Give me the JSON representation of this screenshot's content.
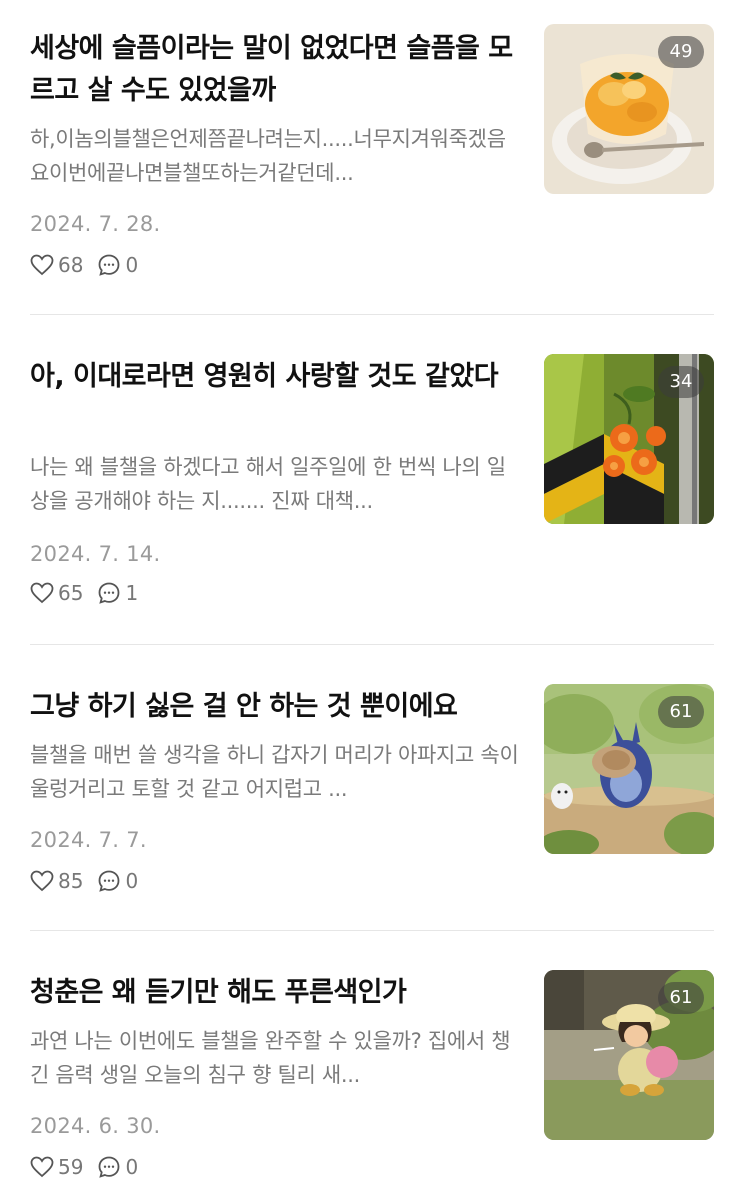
{
  "posts": [
    {
      "title": "세상에 슬픔이라는 말이 없었다면 슬픔을 모르고 살 수도 있었을까",
      "excerpt": "하,이놈의블챌은언제쯤끝나려는지.....너무지겨워죽겠음요이번에끝나면블챌또하는거같던데...",
      "date": "2024. 7. 28.",
      "likes": "68",
      "comments": "0",
      "photo_count": "49",
      "thumb_icon": "mango-dessert-photo"
    },
    {
      "title": "아, 이대로라면 영원히 사랑할 것도 같았다",
      "excerpt": "나는 왜 블챌을 하겠다고 해서 일주일에 한 번씩 나의 일상을 공개해야 하는 지....... 진짜 대책...",
      "date": "2024. 7. 14.",
      "likes": "65",
      "comments": "1",
      "photo_count": "34",
      "thumb_icon": "orange-flowers-photo"
    },
    {
      "title": "그냥 하기 싫은 걸 안 하는 것 뿐이에요",
      "excerpt": "블챌을 매번 쓸 생각을 하니 갑자기 머리가 아파지고 속이 울렁거리고 토할 것 같고 어지럽고 ...",
      "date": "2024. 7. 7.",
      "likes": "85",
      "comments": "0",
      "photo_count": "61",
      "thumb_icon": "totoro-anime-still"
    },
    {
      "title": "청춘은 왜 듣기만 해도 푸른색인가",
      "excerpt": "과연 나는 이번에도 블챌을 완주할 수 있을까? 집에서 챙긴 음력 생일 오늘의 침구 향 틸리 새...",
      "date": "2024. 6. 30.",
      "likes": "59",
      "comments": "0",
      "photo_count": "61",
      "thumb_icon": "girl-anime-still"
    }
  ],
  "colors": {
    "title": "#111111",
    "excerpt": "#7a7a7a",
    "date": "#9a9a9a",
    "divider": "#e6e6e6"
  }
}
